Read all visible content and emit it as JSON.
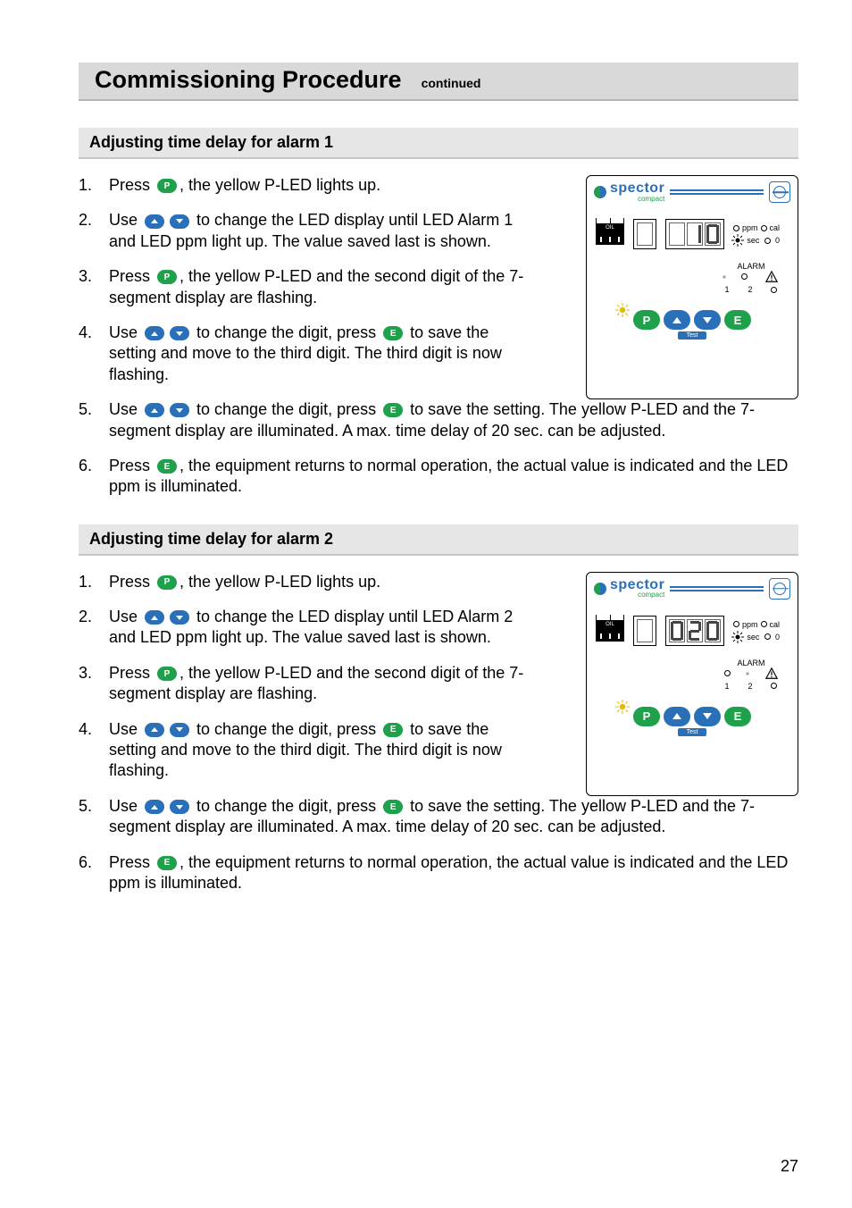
{
  "page_number": "27",
  "title": "Commissioning Procedure",
  "title_suffix": "continued",
  "sections": [
    {
      "heading": "Adjusting time delay for alarm 1",
      "panel": {
        "display": "  10",
        "alarm_active": 1,
        "sec_led_on": true
      },
      "steps": [
        {
          "n": "1.",
          "parts": [
            {
              "t": "Press "
            },
            {
              "icon": "p"
            },
            {
              "t": ", the yellow P-LED lights up."
            }
          ]
        },
        {
          "n": "2.",
          "parts": [
            {
              "t": "Use "
            },
            {
              "icon": "up"
            },
            {
              "icon": "down"
            },
            {
              "t": " to change the LED display until LED Alarm 1 and LED ppm light up. The value saved last is shown."
            }
          ]
        },
        {
          "n": "3.",
          "parts": [
            {
              "t": "Press "
            },
            {
              "icon": "p"
            },
            {
              "t": ", the yellow P-LED and the second digit of the 7-segment display are flashing."
            }
          ]
        },
        {
          "n": "4.",
          "parts": [
            {
              "t": "Use "
            },
            {
              "icon": "up"
            },
            {
              "icon": "down"
            },
            {
              "t": " to change the digit, press "
            },
            {
              "icon": "e"
            },
            {
              "t": " to save the setting and move to the third digit. The third digit is now flashing."
            }
          ]
        },
        {
          "n": "5.",
          "parts": [
            {
              "t": "Use "
            },
            {
              "icon": "up"
            },
            {
              "icon": "down"
            },
            {
              "t": " to change the digit, press "
            },
            {
              "icon": "e"
            },
            {
              "t": " to save the setting. The yellow P-LED and the 7-segment display are illuminated. A max. time delay of 20 sec. can be adjusted."
            }
          ]
        },
        {
          "n": "6.",
          "parts": [
            {
              "t": "Press "
            },
            {
              "icon": "e"
            },
            {
              "t": ", the equipment returns to normal operation, the actual value is indicated and the LED ppm is illuminated."
            }
          ]
        }
      ]
    },
    {
      "heading": "Adjusting time delay for alarm 2",
      "panel": {
        "display": " 020",
        "alarm_active": 2,
        "sec_led_on": true
      },
      "steps": [
        {
          "n": "1.",
          "parts": [
            {
              "t": "Press "
            },
            {
              "icon": "p"
            },
            {
              "t": ", the yellow P-LED lights up."
            }
          ]
        },
        {
          "n": "2.",
          "parts": [
            {
              "t": "Use "
            },
            {
              "icon": "up"
            },
            {
              "icon": "down"
            },
            {
              "t": " to change the LED display until LED Alarm 2 and LED ppm light up. The value saved last is shown."
            }
          ]
        },
        {
          "n": "3.",
          "parts": [
            {
              "t": "Press "
            },
            {
              "icon": "p"
            },
            {
              "t": ", the yellow P-LED and the second digit of the 7-segment display are flashing."
            }
          ]
        },
        {
          "n": "4.",
          "parts": [
            {
              "t": "Use "
            },
            {
              "icon": "up"
            },
            {
              "icon": "down"
            },
            {
              "t": " to change the digit, press "
            },
            {
              "icon": "e"
            },
            {
              "t": " to save the setting and move to the third digit. The third digit is now flashing."
            }
          ]
        },
        {
          "n": "5.",
          "parts": [
            {
              "t": "Use "
            },
            {
              "icon": "up"
            },
            {
              "icon": "down"
            },
            {
              "t": " to change the digit, press "
            },
            {
              "icon": "e"
            },
            {
              "t": " to save the setting. The yellow P-LED and the 7-segment display are illuminated. A max. time delay of 20 sec. can be adjusted."
            }
          ]
        },
        {
          "n": "6.",
          "parts": [
            {
              "t": "Press "
            },
            {
              "icon": "e"
            },
            {
              "t": ", the equipment returns to normal operation, the actual value is indicated and the LED ppm is illuminated."
            }
          ]
        }
      ]
    }
  ],
  "device": {
    "brand": "spector",
    "brand_sub": "compact",
    "oil_label": "OIL",
    "ind_ppm": "ppm",
    "ind_cal": "cal",
    "ind_sec": "sec",
    "ind_zero": "0",
    "alarm_label": "ALARM",
    "alarm_1": "1",
    "alarm_2": "2",
    "test_label": "Test"
  }
}
